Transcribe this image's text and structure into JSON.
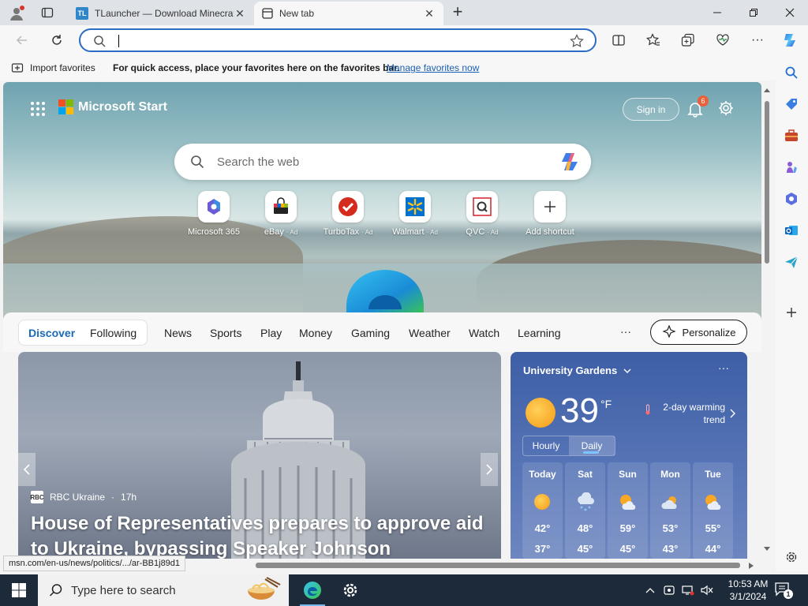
{
  "browser": {
    "tabs": [
      {
        "title": "TLauncher — Download Minecraft",
        "favicon": "TL",
        "active": false
      },
      {
        "title": "New tab",
        "active": true
      }
    ],
    "new_tab_symbol": "+",
    "address": {
      "value": "",
      "placeholder": ""
    }
  },
  "favorites_bar": {
    "import_label": "Import favorites",
    "hint": "For quick access, place your favorites here on the favorites bar.",
    "manage_link": "Manage favorites now"
  },
  "start_page": {
    "brand": "Microsoft Start",
    "sign_in": "Sign in",
    "notification_count": "6",
    "search_placeholder": "Search the web",
    "shortcuts": [
      {
        "label": "Microsoft 365",
        "ad": ""
      },
      {
        "label": "eBay",
        "ad": "· Ad"
      },
      {
        "label": "TurboTax",
        "ad": "· Ad"
      },
      {
        "label": "Walmart",
        "ad": "· Ad"
      },
      {
        "label": "QVC",
        "ad": "· Ad"
      },
      {
        "label": "Add shortcut",
        "ad": ""
      }
    ],
    "feed_tabs": [
      "Discover",
      "Following",
      "News",
      "Sports",
      "Play",
      "Money",
      "Gaming",
      "Weather",
      "Watch",
      "Learning"
    ],
    "more": "···",
    "personalize": "Personalize"
  },
  "news_card": {
    "source": "RBC Ukraine",
    "source_logo": "RBC",
    "age": "17h",
    "headline": "House of Representatives prepares to approve aid to Ukraine, bypassing Speaker Johnson"
  },
  "weather": {
    "location": "University Gardens",
    "temperature": "39",
    "unit": "°F",
    "trend": "2-day warming trend",
    "toggle": [
      "Hourly",
      "Daily"
    ],
    "selected_toggle": "Daily",
    "forecast": [
      {
        "day": "Today",
        "high": "42°",
        "low": "37°",
        "icon": "sunny-icon"
      },
      {
        "day": "Sat",
        "high": "48°",
        "low": "45°",
        "icon": "snow-rain-icon"
      },
      {
        "day": "Sun",
        "high": "59°",
        "low": "45°",
        "icon": "partly-cloudy-icon"
      },
      {
        "day": "Mon",
        "high": "53°",
        "low": "43°",
        "icon": "cloudy-icon"
      },
      {
        "day": "Tue",
        "high": "55°",
        "low": "44°",
        "icon": "partly-cloudy-icon"
      }
    ]
  },
  "status_url": "msn.com/en-us/news/politics/.../ar-BB1j89d1",
  "taskbar": {
    "search_placeholder": "Type here to search",
    "time": "10:53 AM",
    "date": "3/1/2024",
    "notifications": "1"
  },
  "colors": {
    "accent": "#1a6ab8",
    "taskbar": "#1d2a3a",
    "weather_bg": "#4a68ad"
  }
}
